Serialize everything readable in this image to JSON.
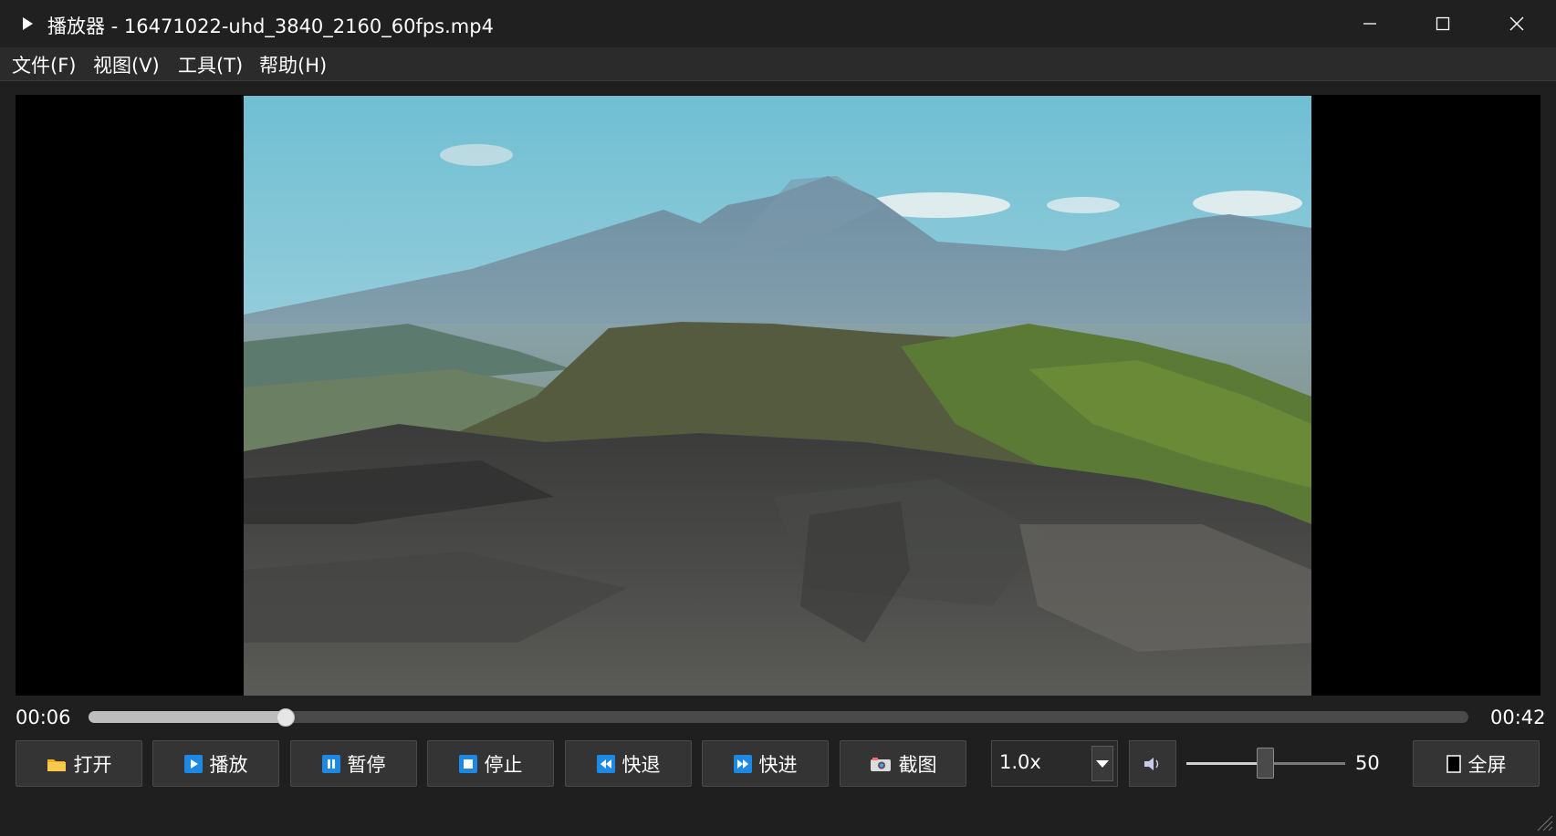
{
  "window": {
    "title": "播放器 - 16471022-uhd_3840_2160_60fps.mp4",
    "app_icon": "play-triangle-icon",
    "controls": [
      "minimize-icon",
      "maximize-icon",
      "close-icon"
    ]
  },
  "menu": [
    {
      "label": "文件(F)"
    },
    {
      "label": "视图(V)"
    },
    {
      "label": "工具(T)"
    },
    {
      "label": "帮助(H)"
    }
  ],
  "player": {
    "current_time": "00:06",
    "total_time": "00:42",
    "progress_fraction": 0.143
  },
  "buttons": {
    "open": {
      "label": "打开",
      "icon": "folder-icon"
    },
    "play": {
      "label": "播放",
      "icon": "play-icon"
    },
    "pause": {
      "label": "暂停",
      "icon": "pause-icon"
    },
    "stop": {
      "label": "停止",
      "icon": "stop-icon"
    },
    "rewind": {
      "label": "快退",
      "icon": "rewind-icon"
    },
    "forward": {
      "label": "快进",
      "icon": "fast-forward-icon"
    },
    "screenshot": {
      "label": "截图",
      "icon": "camera-icon"
    },
    "fullscreen": {
      "label": "全屏",
      "icon": "fullscreen-icon"
    }
  },
  "speed": {
    "selected": "1.0x"
  },
  "volume": {
    "value": "50",
    "level": 0.5,
    "icon": "speaker-icon"
  },
  "colors": {
    "accent": "#1e88e5",
    "titlebar": "#202020",
    "button": "#343434"
  }
}
